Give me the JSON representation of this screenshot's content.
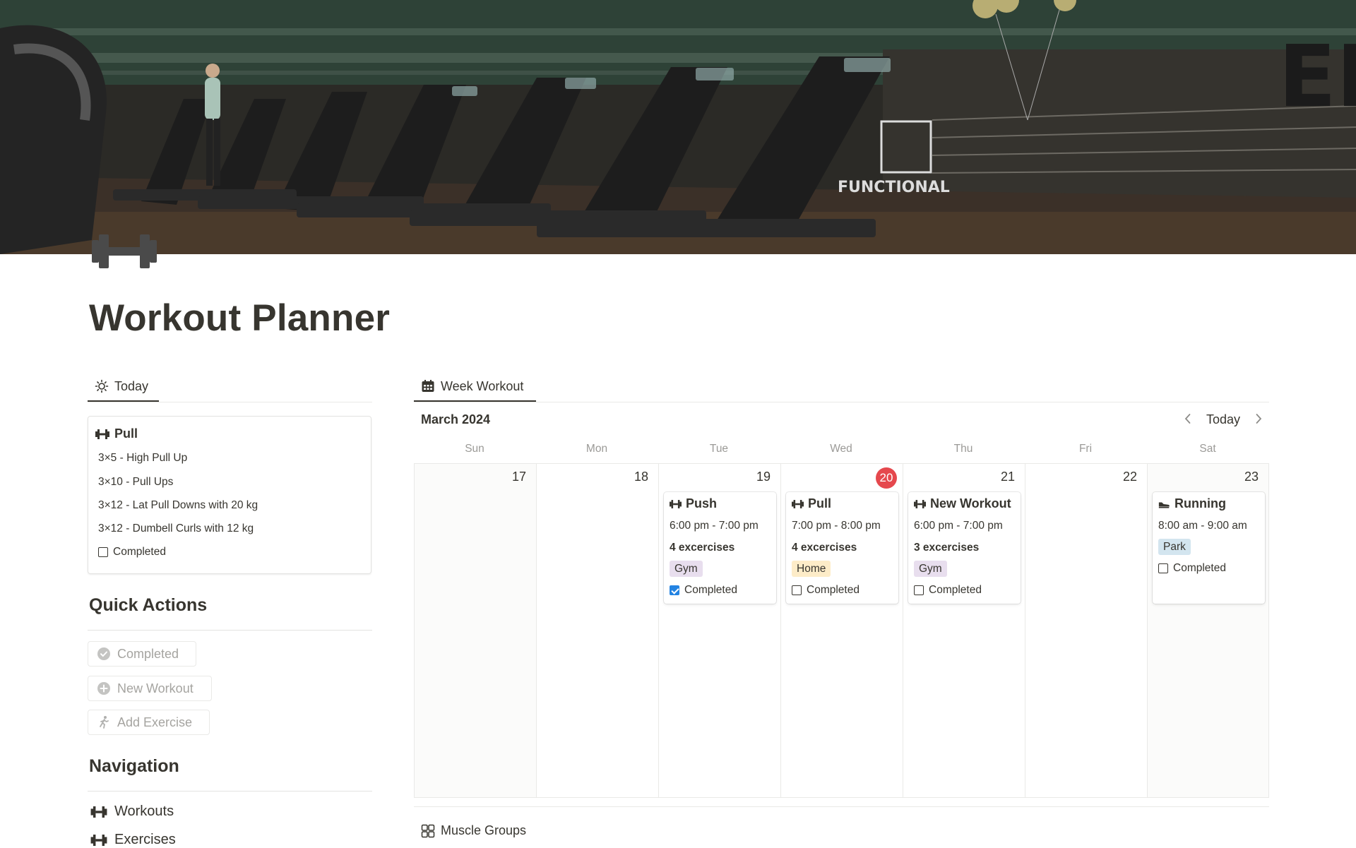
{
  "page": {
    "title": "Workout Planner",
    "cover": "gym-treadmills-photo",
    "icon": "dumbbell-icon"
  },
  "today": {
    "tab_label": "Today",
    "card": {
      "title": "Pull",
      "exercises": [
        "3×5 - High Pull Up",
        "3×10 - Pull Ups",
        "3×12 - Lat Pull Downs with 20 kg",
        "3×12 - Dumbell Curls with 12 kg"
      ],
      "completed_label": "Completed",
      "completed": false
    }
  },
  "quick_actions": {
    "heading": "Quick Actions",
    "buttons": [
      {
        "label": "Completed",
        "icon": "check-circle-icon"
      },
      {
        "label": "New Workout",
        "icon": "plus-circle-icon"
      },
      {
        "label": "Add Exercise",
        "icon": "running-person-icon"
      }
    ]
  },
  "navigation": {
    "heading": "Navigation",
    "items": [
      {
        "label": "Workouts",
        "icon": "dumbbell-icon"
      },
      {
        "label": "Exercises",
        "icon": "dumbbell-icon"
      }
    ]
  },
  "week": {
    "tab_label": "Week Workout",
    "month": "March 2024",
    "today_button": "Today",
    "days_of_week": [
      "Sun",
      "Mon",
      "Tue",
      "Wed",
      "Thu",
      "Fri",
      "Sat"
    ],
    "dates": [
      "17",
      "18",
      "19",
      "20",
      "21",
      "22",
      "23"
    ],
    "today_index": 3,
    "events": [
      {
        "title": "Push",
        "time": "6:00 pm - 7:00 pm",
        "count": "4 excercises",
        "tag": "Gym",
        "completed_label": "Completed",
        "completed": true
      },
      {
        "title": "Pull",
        "time": "7:00 pm - 8:00 pm",
        "count": "4 excercises",
        "tag": "Home",
        "completed_label": "Completed",
        "completed": false
      },
      {
        "title": "New Workout",
        "time": "6:00 pm - 7:00 pm",
        "count": "3 excercises",
        "tag": "Gym",
        "completed_label": "Completed",
        "completed": false
      },
      {
        "title": "Running",
        "time": "8:00 am - 9:00 am",
        "tag": "Park",
        "completed_label": "Completed",
        "completed": false
      }
    ]
  },
  "muscle_groups": {
    "label": "Muscle Groups"
  },
  "colors": {
    "text": "#37352f",
    "muted": "#9b9a97",
    "today_badge": "#e5484d",
    "checkbox_checked": "#2383e2",
    "tag_gym": "#e8deee",
    "tag_home": "#fdecc8",
    "tag_park": "#d3e5ef"
  }
}
